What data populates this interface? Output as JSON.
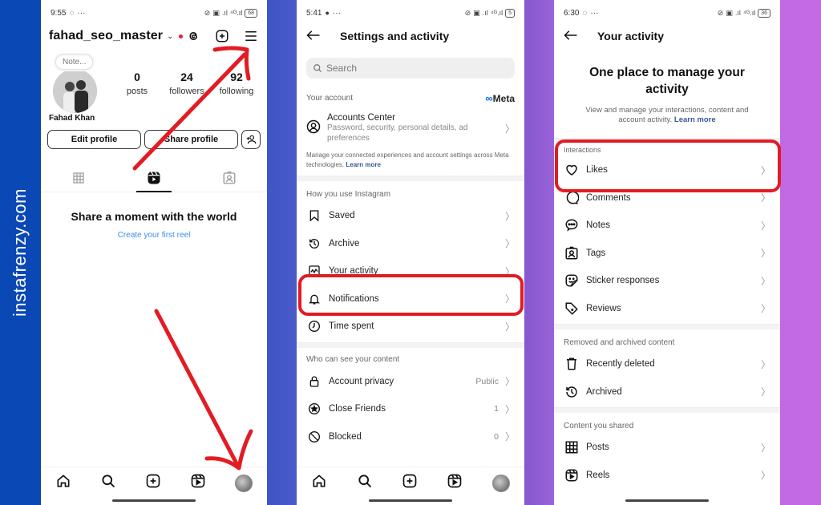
{
  "brand": {
    "watermark": "instafrenzy.com"
  },
  "colors": {
    "annotation_red": "#e31b23",
    "link_blue": "#3d8ee6",
    "meta_blue": "#0866ff",
    "notification_dot": "#e2213a"
  },
  "profile_screen": {
    "status": {
      "time": "9:55",
      "app_icon": "whatsapp-icon",
      "more": "···",
      "battery": "68"
    },
    "username": "fahad_seo_master",
    "header_icons": [
      "threads-icon",
      "create-icon",
      "menu-icon"
    ],
    "note_placeholder": "Note...",
    "full_name": "Fahad Khan",
    "stats": [
      {
        "value": "0",
        "label": "posts"
      },
      {
        "value": "24",
        "label": "followers"
      },
      {
        "value": "92",
        "label": "following"
      }
    ],
    "buttons": {
      "edit": "Edit profile",
      "share": "Share profile"
    },
    "tabs": [
      "grid",
      "reels",
      "tagged"
    ],
    "active_tab": "reels",
    "empty_title": "Share a moment with the world",
    "empty_link": "Create your first reel",
    "bottom_nav": [
      "home",
      "search",
      "create",
      "reels",
      "profile"
    ]
  },
  "settings_screen": {
    "status": {
      "time": "5:41",
      "app_icon": "message-icon",
      "more": "···",
      "battery": "5"
    },
    "title": "Settings and activity",
    "search_placeholder": "Search",
    "your_account": {
      "heading": "Your account",
      "meta_label": "Meta",
      "accounts_center_title": "Accounts Center",
      "accounts_center_sub": "Password, security, personal details, ad preferences",
      "note": "Manage your connected experiences and account settings across Meta technologies.",
      "learn_more": "Learn more"
    },
    "how_you_use": {
      "heading": "How you use Instagram",
      "items": [
        {
          "label": "Saved",
          "icon": "bookmark"
        },
        {
          "label": "Archive",
          "icon": "archive"
        },
        {
          "label": "Your activity",
          "icon": "activity"
        },
        {
          "label": "Notifications",
          "icon": "bell"
        },
        {
          "label": "Time spent",
          "icon": "clock"
        }
      ]
    },
    "who_can_see": {
      "heading": "Who can see your content",
      "items": [
        {
          "label": "Account privacy",
          "value": "Public",
          "icon": "lock"
        },
        {
          "label": "Close Friends",
          "value": "1",
          "icon": "star"
        },
        {
          "label": "Blocked",
          "value": "0",
          "icon": "blocked"
        }
      ]
    },
    "highlighted_item": "Your activity"
  },
  "activity_screen": {
    "status": {
      "time": "6:30",
      "app_icon": "whatsapp-icon",
      "more": "···",
      "battery": "36"
    },
    "title": "Your activity",
    "hero_title": "One place to manage your activity",
    "hero_sub": "View and manage your interactions, content and account activity.",
    "learn_more": "Learn more",
    "interactions": {
      "heading": "Interactions",
      "items": [
        {
          "label": "Likes",
          "icon": "heart"
        },
        {
          "label": "Comments",
          "icon": "comment"
        },
        {
          "label": "Notes",
          "icon": "notes"
        },
        {
          "label": "Tags",
          "icon": "tag"
        },
        {
          "label": "Sticker responses",
          "icon": "sticker"
        },
        {
          "label": "Reviews",
          "icon": "review"
        }
      ]
    },
    "removed": {
      "heading": "Removed and archived content",
      "items": [
        {
          "label": "Recently deleted",
          "icon": "trash"
        },
        {
          "label": "Archived",
          "icon": "archive"
        }
      ]
    },
    "shared": {
      "heading": "Content you shared",
      "items": [
        {
          "label": "Posts",
          "icon": "grid"
        },
        {
          "label": "Reels",
          "icon": "reels"
        }
      ]
    },
    "highlighted_item": "Likes"
  }
}
